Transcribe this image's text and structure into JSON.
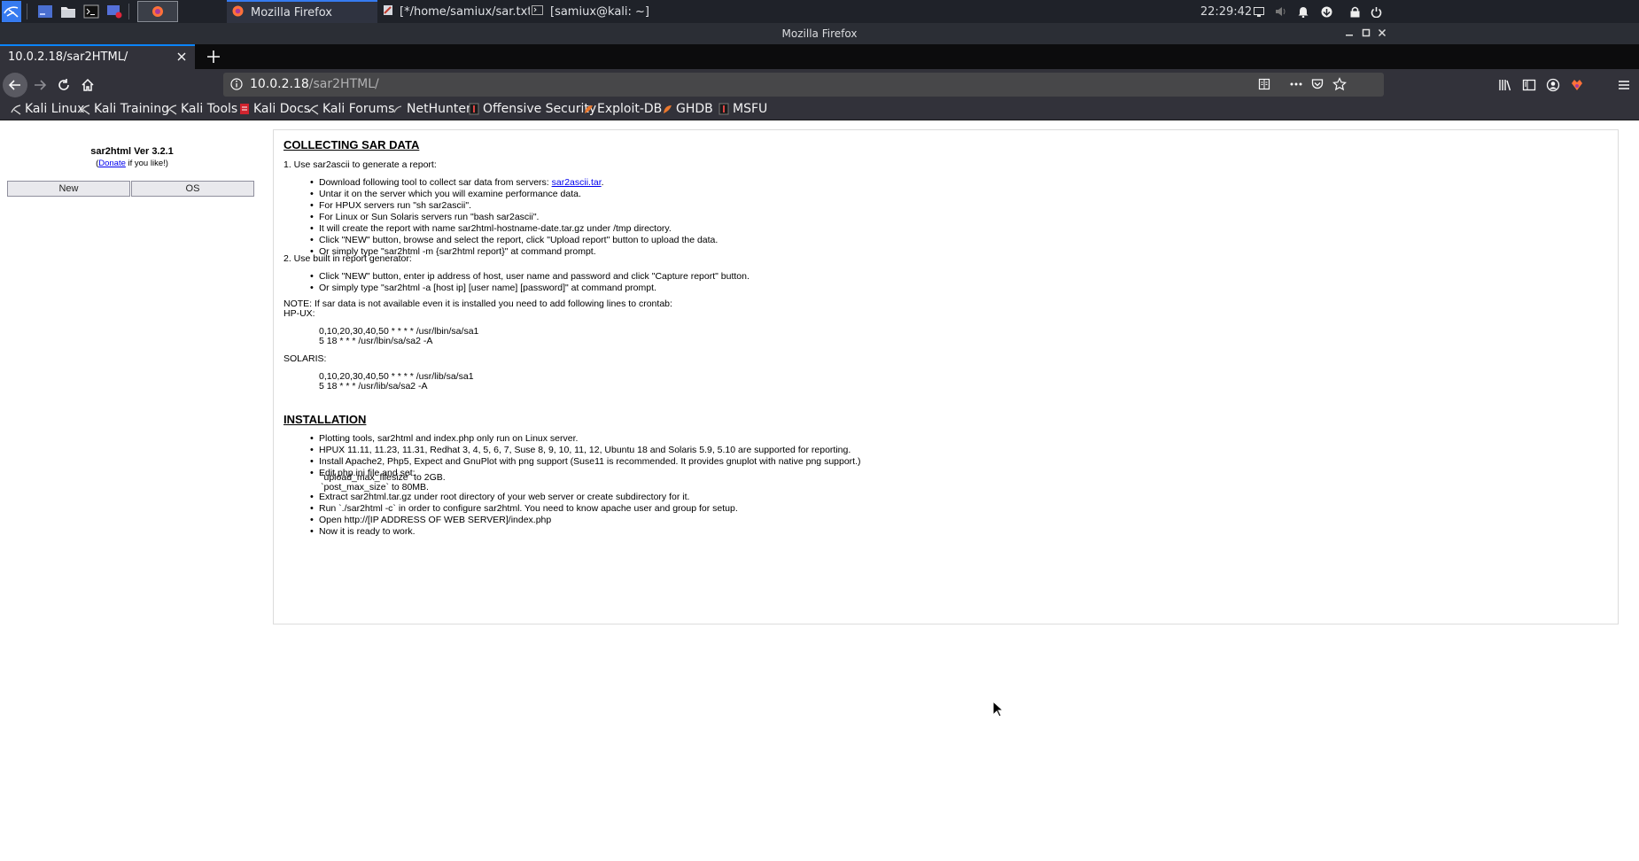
{
  "panel": {
    "clock": "22:29:42",
    "tasks": [
      {
        "label": "Mozilla Firefox",
        "active": true
      },
      {
        "label": "[*/home/samiux/sar.txt ...",
        "active": false
      },
      {
        "label": "[samiux@kali: ~]",
        "active": false
      }
    ]
  },
  "window": {
    "title": "Mozilla Firefox"
  },
  "browser": {
    "tab_title": "10.0.2.18/sar2HTML/",
    "url_host": "10.0.2.18",
    "url_path": "/sar2HTML/",
    "bookmarks": [
      "Kali Linux",
      "Kali Training",
      "Kali Tools",
      "Kali Docs",
      "Kali Forums",
      "NetHunter",
      "Offensive Security",
      "Exploit-DB",
      "GHDB",
      "MSFU"
    ]
  },
  "app": {
    "title": "sar2html Ver 3.2.1",
    "donate_prefix": "(",
    "donate_link": "Donate",
    "donate_suffix": " if you like!)",
    "buttons": [
      "New",
      "OS"
    ]
  },
  "collecting": {
    "heading": "COLLECTING SAR DATA",
    "step1": "1. Use sar2ascii to generate a report:",
    "step1_download_prefix": "Download following tool to collect sar data from servers: ",
    "step1_download_link": "sar2ascii.tar",
    "step1_download_suffix": ".",
    "step1_items": [
      "Untar it on the server which you will examine performance data.",
      "For HPUX servers run \"sh sar2ascii\".",
      "For Linux or Sun Solaris servers run \"bash sar2ascii\".",
      "It will create the report with name sar2html-hostname-date.tar.gz under /tmp directory.",
      "Click \"NEW\" button, browse and select the report, click \"Upload report\" button to upload the data.",
      "Or simply type \"sar2html -m {sar2html report}\" at command prompt."
    ],
    "step2": "2. Use built in report generator:",
    "step2_items": [
      "Click \"NEW\" button, enter ip address of host, user name and password and click \"Capture report\" button.",
      "Or simply type \"sar2html -a [host ip] [user name] [password]\" at command prompt."
    ],
    "note": "NOTE: If sar data is not available even it is installed you need to add following lines to crontab:",
    "hpux_label": "HP-UX:",
    "hpux_lines": [
      "0,10,20,30,40,50 * * * * /usr/lbin/sa/sa1",
      "5 18 * * * /usr/lbin/sa/sa2 -A"
    ],
    "solaris_label": "SOLARIS:",
    "solaris_lines": [
      "0,10,20,30,40,50 * * * * /usr/lib/sa/sa1",
      "5 18 * * * /usr/lib/sa/sa2 -A"
    ]
  },
  "installation": {
    "heading": "INSTALLATION",
    "items": [
      "Plotting tools, sar2html and index.php only run on Linux server.",
      "HPUX 11.11, 11.23, 11.31, Redhat 3, 4, 5, 6, 7, Suse 8, 9, 10, 11, 12, Ubuntu 18 and Solaris 5.9, 5.10 are supported for reporting.",
      "Install Apache2, Php5, Expect and GnuPlot with png support (Suse11 is recommended. It provides gnuplot with native png support.)",
      "Edit php.ini file and set:"
    ],
    "php_settings": [
      "`upload_max_filesize` to 2GB.",
      "`post_max_size` to 80MB."
    ],
    "items2": [
      "Extract sar2html.tar.gz under root directory of your web server or create subdirectory for it.",
      "Run `./sar2html -c` in order to configure sar2html. You need to know apache user and group for setup.",
      "Open http://[IP ADDRESS OF WEB SERVER]/index.php",
      "Now it is ready to work."
    ]
  }
}
